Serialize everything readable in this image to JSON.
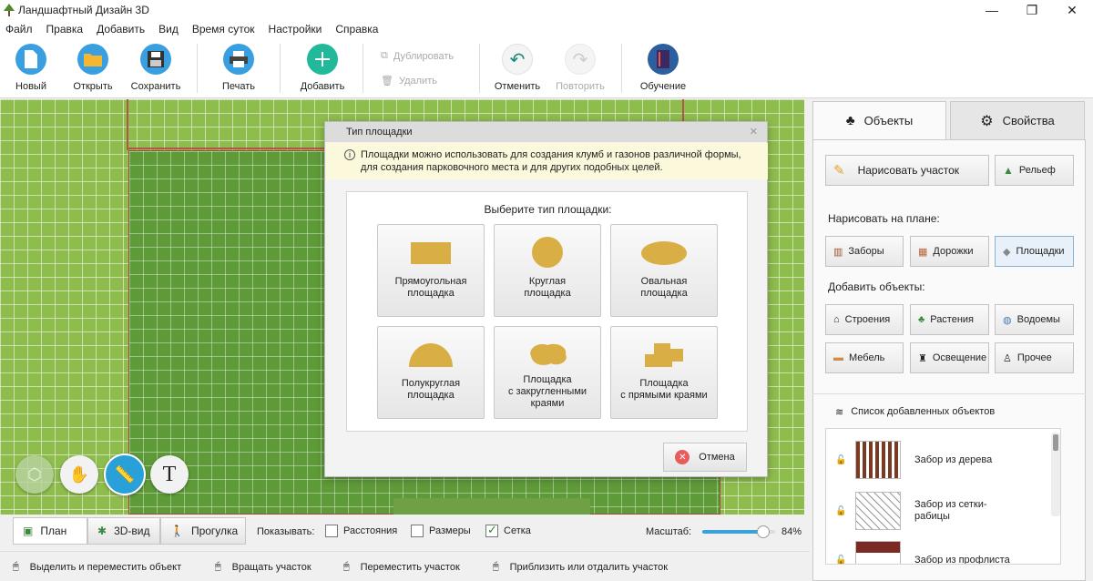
{
  "window": {
    "title": "Ландшафтный Дизайн 3D",
    "minimize": "—",
    "maximize": "❐",
    "close": "✕"
  },
  "menu": [
    "Файл",
    "Правка",
    "Добавить",
    "Вид",
    "Время суток",
    "Настройки",
    "Справка"
  ],
  "toolbar": {
    "new": "Новый",
    "open": "Открыть",
    "save": "Сохранить",
    "print": "Печать",
    "add": "Добавить",
    "duplicate": "Дублировать",
    "delete": "Удалить",
    "undo": "Отменить",
    "redo": "Повторить",
    "tutorial": "Обучение"
  },
  "dialog": {
    "title": "Тип площадки",
    "info_line1": "Площадки можно использовать для создания клумб и газонов различной формы,",
    "info_line2": "для создания парковочного места и для других подобных целей.",
    "prompt": "Выберите тип площадки:",
    "options": [
      {
        "line1": "Прямоугольная",
        "line2": "площадка",
        "line3": ""
      },
      {
        "line1": "Круглая",
        "line2": "площадка",
        "line3": ""
      },
      {
        "line1": "Овальная",
        "line2": "площадка",
        "line3": ""
      },
      {
        "line1": "Полукруглая",
        "line2": "площадка",
        "line3": ""
      },
      {
        "line1": "Площадка",
        "line2": "с закругленными",
        "line3": "краями"
      },
      {
        "line1": "Площадка",
        "line2": "с прямыми краями",
        "line3": ""
      }
    ],
    "cancel": "Отмена",
    "shape_color": "#d9ae45"
  },
  "right": {
    "tab_objects": "Объекты",
    "tab_properties": "Свойства",
    "draw_plot": "Нарисовать участок",
    "relief": "Рельеф",
    "draw_on_plan": "Нарисовать на плане:",
    "fences": "Заборы",
    "paths": "Дорожки",
    "areas": "Площадки",
    "add_objects": "Добавить объекты:",
    "buildings": "Строения",
    "plants": "Растения",
    "water": "Водоемы",
    "furniture": "Мебель",
    "lighting": "Освещение",
    "other": "Прочее",
    "list_title": "Список добавленных объектов",
    "list": [
      {
        "line1": "Забор из дерева",
        "line2": ""
      },
      {
        "line1": "Забор из сетки-",
        "line2": "рабицы"
      },
      {
        "line1": "Забор из профлиста",
        "line2": ""
      }
    ]
  },
  "views": {
    "plan": "План",
    "view3d": "3D-вид",
    "walk": "Прогулка"
  },
  "show": {
    "label": "Показывать:",
    "distances": "Расстояния",
    "sizes": "Размеры",
    "grid": "Сетка",
    "grid_checked": true
  },
  "zoom": {
    "label": "Масштаб:",
    "value": "84%",
    "level": 0.84
  },
  "status": {
    "select": "Выделить и переместить объект",
    "rotate": "Вращать участок",
    "move": "Переместить участок",
    "zoom": "Приблизить или отдалить участок"
  },
  "colors": {
    "grass": "#8ebd4d",
    "lawn": "#5e9a38",
    "accent": "#2aa0d8"
  }
}
